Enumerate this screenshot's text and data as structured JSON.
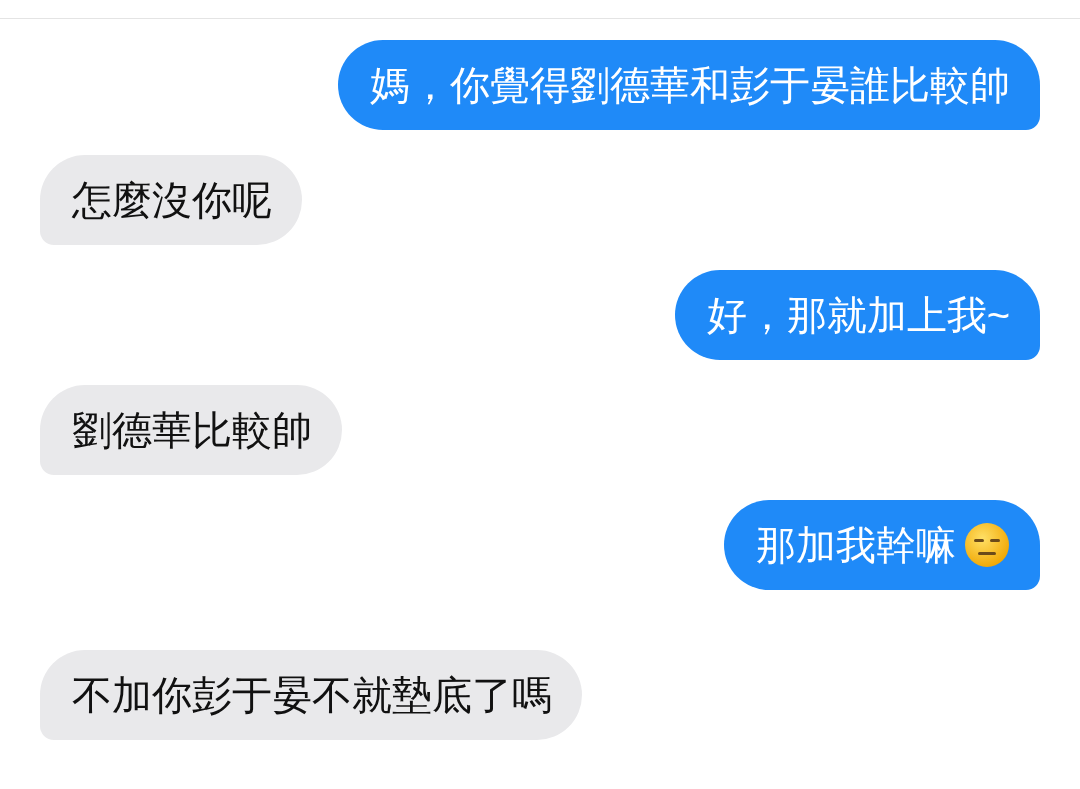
{
  "messages": [
    {
      "kind": "sent",
      "text": "媽，你覺得劉德華和彭于晏誰比較帥"
    },
    {
      "kind": "received",
      "text": "怎麼沒你呢"
    },
    {
      "kind": "sent",
      "text": "好，那就加上我~"
    },
    {
      "kind": "received",
      "text": "劉德華比較帥"
    },
    {
      "kind": "sent",
      "text": "那加我幹嘛",
      "emoji": true
    },
    {
      "kind": "received",
      "text": "不加你彭于晏不就墊底了嗎"
    }
  ]
}
